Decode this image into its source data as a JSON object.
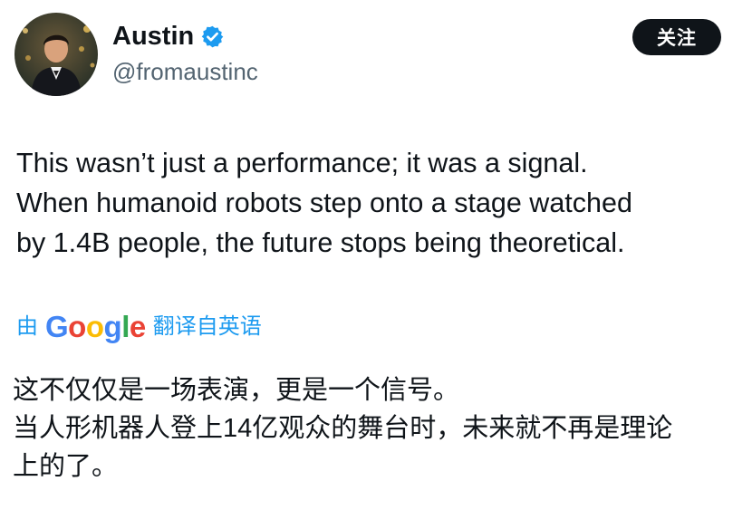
{
  "author": {
    "name": "Austin",
    "handle": "@fromaustinc",
    "verified_color": "#1d9bf0"
  },
  "follow_button": {
    "label": "关注"
  },
  "tweet": {
    "lines": [
      "This wasn’t just a performance; it was a signal.",
      "When humanoid robots step onto a stage watched",
      "by 1.4B people, the future stops being theoretical."
    ]
  },
  "translation": {
    "prefix": "由",
    "provider_letters": [
      "G",
      "o",
      "o",
      "g",
      "l",
      "e"
    ],
    "provider_colors": [
      "#4285f4",
      "#ea4335",
      "#fbbc05",
      "#4285f4",
      "#34a853",
      "#ea4335"
    ],
    "suffix": "翻译自英语",
    "lines": [
      "这不仅仅是一场表演，更是一个信号。",
      "当人形机器人登上14亿观众的舞台时，未来就不再是理论",
      "上的了。"
    ]
  }
}
